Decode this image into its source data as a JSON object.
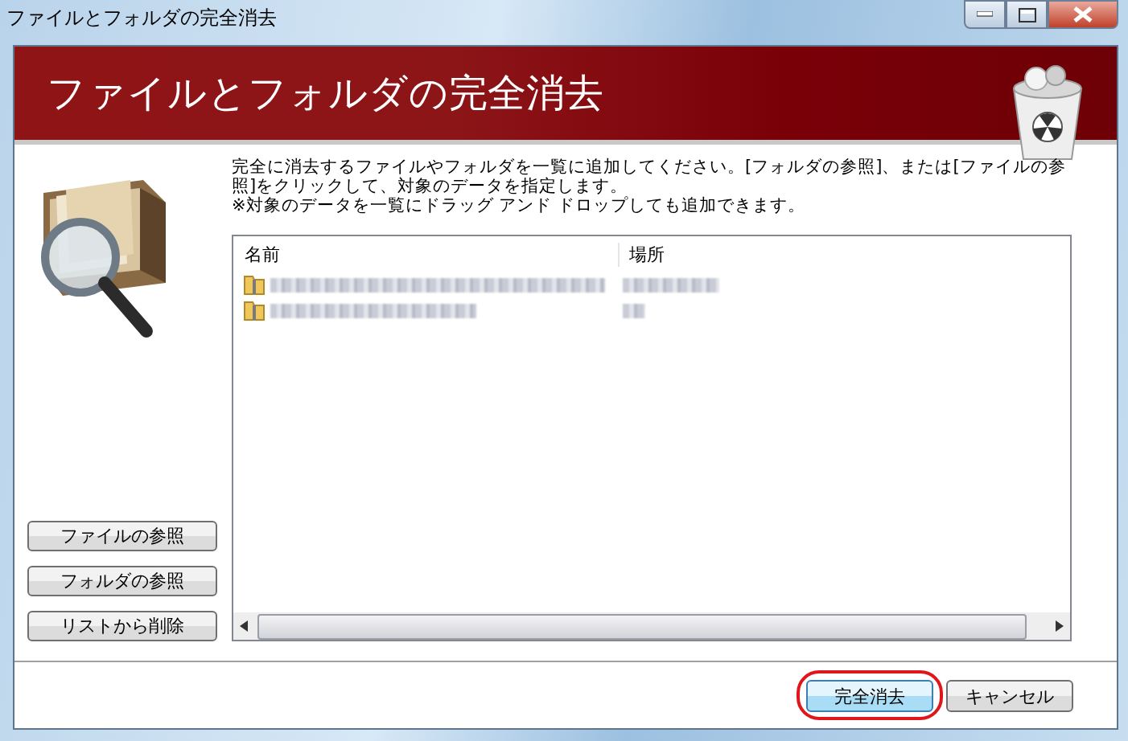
{
  "window": {
    "title": "ファイルとフォルダの完全消去"
  },
  "banner": {
    "title": "ファイルとフォルダの完全消去"
  },
  "instructions": [
    "完全に消去するファイルやフォルダを一覧に追加してください。[フォルダの参照]、または[ファイルの参照]をクリックして、対象のデータを指定します。",
    "※対象のデータを一覧にドラッグ アンド ドロップしても追加できます。"
  ],
  "list": {
    "columns": [
      "名前",
      "場所"
    ],
    "rows": [
      {
        "kind": "zip-folder"
      },
      {
        "kind": "zip-folder"
      }
    ]
  },
  "side_buttons": [
    "ファイルの参照",
    "フォルダの参照",
    "リストから削除"
  ],
  "buttons": [
    {
      "label": "完全消去",
      "default": true,
      "highlighted": true
    },
    {
      "label": "キャンセル",
      "default": false,
      "highlighted": false
    }
  ]
}
